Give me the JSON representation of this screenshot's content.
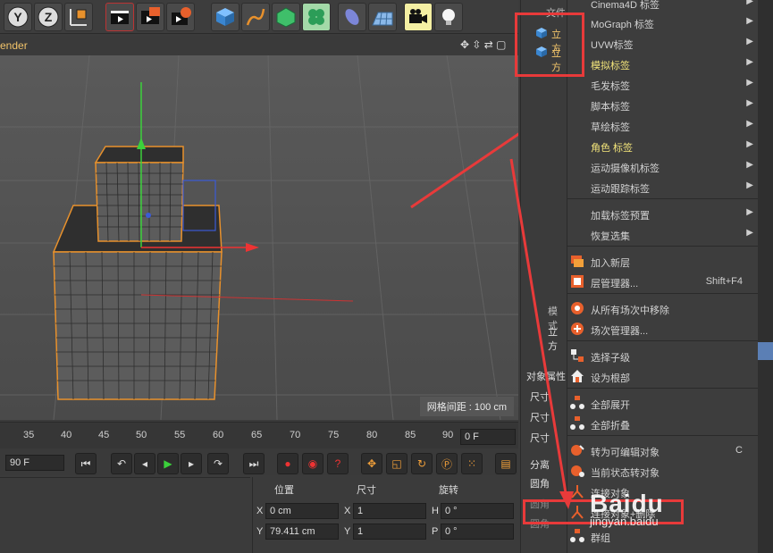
{
  "viewport": {
    "header_text": "ender",
    "grid_info": "网格间距 : 100 cm"
  },
  "timeline": {
    "ticks": [
      "35",
      "40",
      "45",
      "50",
      "55",
      "60",
      "65",
      "70",
      "75",
      "80",
      "85",
      "90"
    ],
    "current_frame": "0 F",
    "end_frame": "90 F"
  },
  "coords": {
    "headers": {
      "position": "位置",
      "size": "尺寸",
      "rotation": "旋转"
    },
    "rows": [
      {
        "axis": "X",
        "pos": "0 cm",
        "size_axis": "X",
        "size": "1",
        "rot_axis": "H",
        "rot": "0 °"
      },
      {
        "axis": "Y",
        "pos": "79.411 cm",
        "size_axis": "Y",
        "size": "1",
        "rot_axis": "P",
        "rot": "0 °"
      }
    ]
  },
  "panel": {
    "file_label": "文件",
    "objects": [
      "立方",
      "立方"
    ],
    "mode_label": "模式",
    "obj_label": "立方",
    "attr_label": "对象属性",
    "props": [
      "尺寸",
      "尺寸",
      "尺寸",
      "分离",
      "圆角",
      "圆角",
      "圆角"
    ]
  },
  "menu": {
    "items": [
      {
        "label": "Cinema4D 标签",
        "arrow": true
      },
      {
        "label": "MoGraph 标签",
        "arrow": true
      },
      {
        "label": "UVW标签",
        "arrow": true
      },
      {
        "label": "模拟标签",
        "arrow": true,
        "highlight": true
      },
      {
        "label": "毛发标签",
        "arrow": true
      },
      {
        "label": "脚本标签",
        "arrow": true
      },
      {
        "label": "草绘标签",
        "arrow": true
      },
      {
        "label": "角色 标签",
        "arrow": true,
        "highlight": true
      },
      {
        "label": "运动摄像机标签",
        "arrow": true
      },
      {
        "label": "运动跟踪标签",
        "arrow": true
      },
      {
        "label": "加载标签预置",
        "arrow": true
      },
      {
        "label": "恢复选集",
        "arrow": true
      },
      {
        "label": "加入新层",
        "icon": "layer-add-icon"
      },
      {
        "label": "层管理器...",
        "icon": "layer-manager-icon",
        "shortcut": "Shift+F4"
      },
      {
        "label": "从所有场次中移除",
        "icon": "take-remove-icon"
      },
      {
        "label": "场次管理器...",
        "icon": "take-manager-icon"
      },
      {
        "label": "选择子级",
        "icon": "select-children-icon"
      },
      {
        "label": "设为根部",
        "icon": "set-root-icon"
      },
      {
        "label": "全部展开",
        "icon": "expand-all-icon"
      },
      {
        "label": "全部折叠",
        "icon": "collapse-all-icon"
      },
      {
        "label": "转为可编辑对象",
        "icon": "make-editable-icon",
        "shortcut": "C"
      },
      {
        "label": "当前状态转对象",
        "icon": "current-state-icon"
      },
      {
        "label": "连接对象",
        "icon": "connect-objects-icon"
      },
      {
        "label": "连接对象+删除",
        "icon": "connect-delete-icon"
      },
      {
        "label": "群组",
        "icon": "group-icon"
      }
    ]
  },
  "watermark": {
    "brand": "Baidu",
    "sub": "jingyan.baidu"
  },
  "colors": {
    "accent_yellow": "#f2e47a",
    "annotation_red": "#e83a3a",
    "header_orange": "#f2c46a"
  }
}
